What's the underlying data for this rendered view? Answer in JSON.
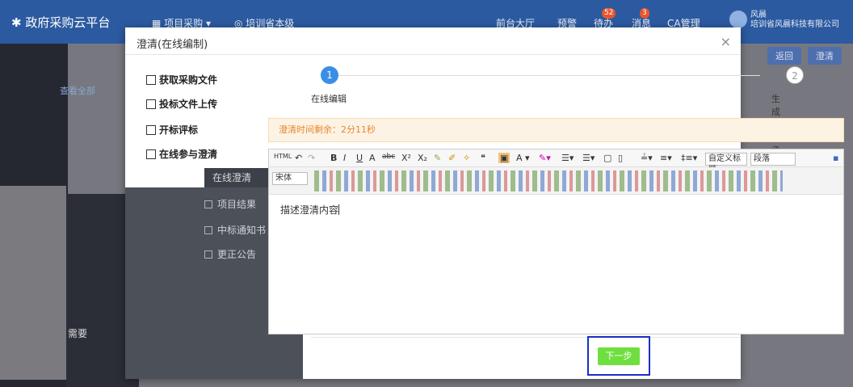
{
  "topbar": {
    "logo": "政府采购云平台",
    "project_menu": "项目采购",
    "location": "培训省本级",
    "front_hall": "前台大厅",
    "warning": "预警",
    "todo": "待办",
    "todo_count": "52",
    "message": "消息",
    "message_count": "3",
    "ca": "CA管理",
    "user_name": "风晨",
    "user_company": "培训省风晨科技有限公司"
  },
  "background": {
    "requirement_label": "需要",
    "view_all": "查看全部",
    "return_button": "返回",
    "clarify_button": "澄清"
  },
  "modal": {
    "title": "澄清(在线编制)",
    "close": "×"
  },
  "menu": {
    "items": [
      {
        "label": "获取采购文件"
      },
      {
        "label": "投标文件上传"
      },
      {
        "label": "开标评标"
      },
      {
        "label": "在线参与澄清"
      }
    ],
    "active_label": "在线澄清",
    "dark_items": [
      {
        "label": "项目结果"
      },
      {
        "label": "中标通知书"
      },
      {
        "label": "更正公告"
      }
    ]
  },
  "steps": [
    {
      "number": "1",
      "label": "在线编辑"
    },
    {
      "number": "2",
      "label": "生成澄清函"
    }
  ],
  "timer": {
    "text": "澄清时间剩余：2分11秒"
  },
  "editor": {
    "toolbar": {
      "html": "HTML",
      "custom_title": "自定义标题",
      "paragraph": "段落",
      "font": "宋体"
    },
    "content": "描述澄清内容"
  },
  "footer": {
    "next_label": "下一步"
  },
  "colors": {
    "topbar": "#2c5aa0",
    "step_active": "#3a8ee6",
    "timer_text": "#e6862e",
    "next_button": "#6fdf3f",
    "highlight": "#1a2fc4"
  }
}
